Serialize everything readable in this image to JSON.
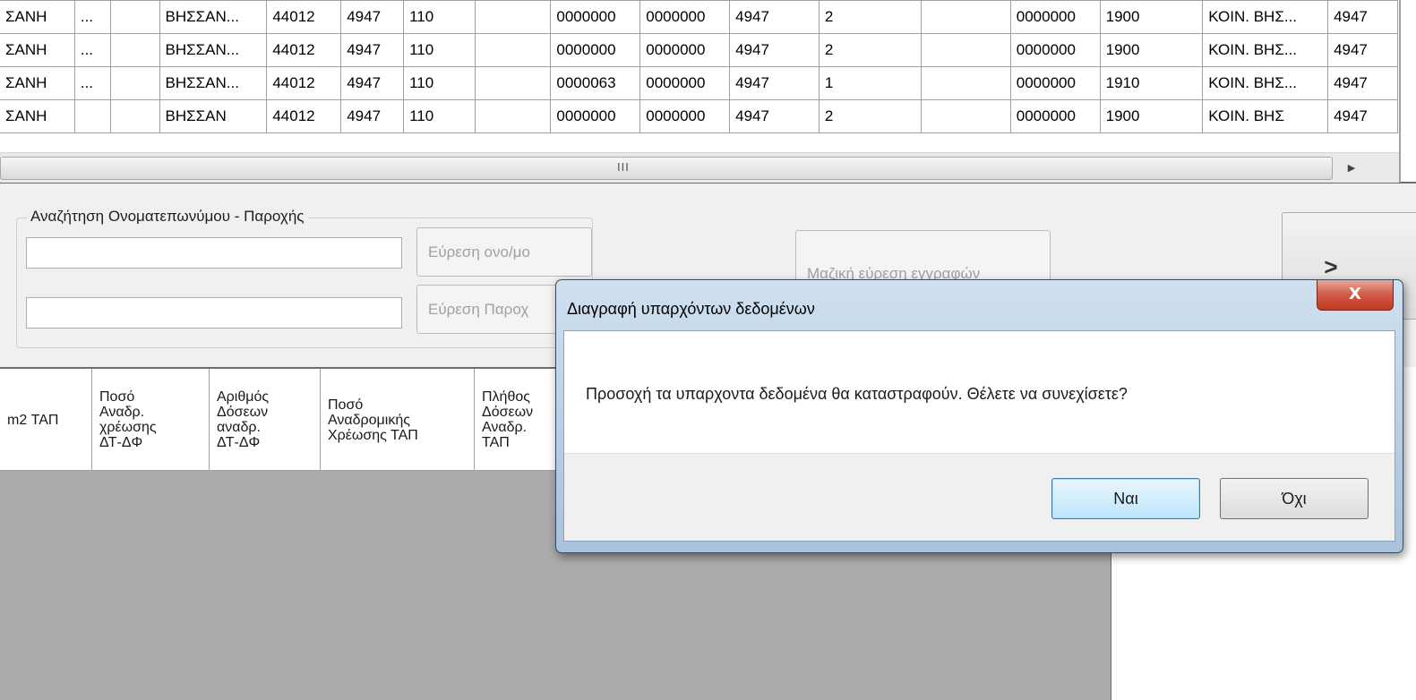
{
  "top_grid": {
    "rows": [
      [
        "ΣΑΝΗ",
        "...",
        "",
        "ΒΗΣΣΑΝ...",
        "44012",
        "4947",
        "110",
        "",
        "0000000",
        "0000000",
        "4947",
        "2",
        "",
        "0000000",
        "1900",
        "ΚΟΙΝ. ΒΗΣ...",
        "4947"
      ],
      [
        "ΣΑΝΗ",
        "...",
        "",
        "ΒΗΣΣΑΝ...",
        "44012",
        "4947",
        "110",
        "",
        "0000000",
        "0000000",
        "4947",
        "2",
        "",
        "0000000",
        "1900",
        "ΚΟΙΝ. ΒΗΣ...",
        "4947"
      ],
      [
        "ΣΑΝΗ",
        "...",
        "",
        "ΒΗΣΣΑΝ...",
        "44012",
        "4947",
        "110",
        "",
        "0000063",
        "0000000",
        "4947",
        "1",
        "",
        "0000000",
        "1910",
        "ΚΟΙΝ. ΒΗΣ...",
        "4947"
      ],
      [
        "ΣΑΝΗ",
        "",
        "",
        "ΒΗΣΣΑΝ",
        "44012",
        "4947",
        "110",
        "",
        "0000000",
        "0000000",
        "4947",
        "2",
        "",
        "0000000",
        "1900",
        "ΚΟΙΝ. ΒΗΣ",
        "4947"
      ]
    ],
    "scroll_grip": "III",
    "scroll_right_arrow": "▶"
  },
  "search_group": {
    "legend": "Αναζήτηση Ονοματεπωνύμου - Παροχής",
    "name_input_value": "",
    "supply_input_value": "",
    "find_name_label": "Εύρεση ονο/μο",
    "find_supply_label": "Εύρεση Παροχ"
  },
  "bulk_find_label": "Μαζική εύρεση εγγραφών",
  "next_button_label": ">",
  "bottom_grid": {
    "headers": [
      "m2 ΤΑΠ",
      "Ποσό\nΑναδρ.\nχρέωσης\nΔΤ-ΔΦ",
      "Αριθμός\nΔόσεων\nαναδρ.\nΔΤ-ΔΦ",
      "Ποσό\nΑναδρομικής\nΧρέωσης ΤΑΠ",
      "Πλήθος\nΔόσεων\nΑναδρ.\nΤΑΠ"
    ]
  },
  "dialog": {
    "title": "Διαγραφή υπαρχόντων δεδομένων",
    "close_glyph": "X",
    "message": "Προσοχή τα υπαρχοντα δεδομένα θα καταστραφούν. Θέλετε να συνεχίσετε?",
    "yes_label": "Ναι",
    "no_label": "Όχι"
  }
}
